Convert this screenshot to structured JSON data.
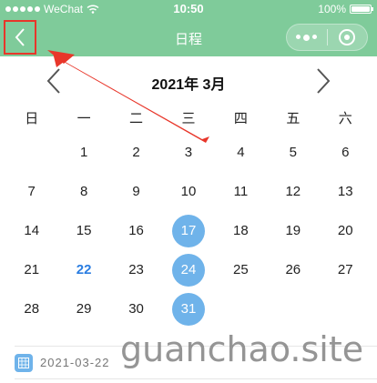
{
  "status_bar": {
    "carrier": "WeChat",
    "time": "10:50",
    "battery": "100%"
  },
  "nav": {
    "title": "日程"
  },
  "calendar": {
    "month_title": "2021年 3月",
    "weekdays": [
      "日",
      "一",
      "二",
      "三",
      "四",
      "五",
      "六"
    ],
    "days": [
      {
        "label": "",
        "state": "empty"
      },
      {
        "label": "1",
        "state": "normal"
      },
      {
        "label": "2",
        "state": "normal"
      },
      {
        "label": "3",
        "state": "normal"
      },
      {
        "label": "4",
        "state": "normal"
      },
      {
        "label": "5",
        "state": "normal"
      },
      {
        "label": "6",
        "state": "normal"
      },
      {
        "label": "7",
        "state": "normal"
      },
      {
        "label": "8",
        "state": "normal"
      },
      {
        "label": "9",
        "state": "normal"
      },
      {
        "label": "10",
        "state": "normal"
      },
      {
        "label": "11",
        "state": "normal"
      },
      {
        "label": "12",
        "state": "normal"
      },
      {
        "label": "13",
        "state": "normal"
      },
      {
        "label": "14",
        "state": "normal"
      },
      {
        "label": "15",
        "state": "normal"
      },
      {
        "label": "16",
        "state": "normal"
      },
      {
        "label": "17",
        "state": "marked"
      },
      {
        "label": "18",
        "state": "normal"
      },
      {
        "label": "19",
        "state": "normal"
      },
      {
        "label": "20",
        "state": "normal"
      },
      {
        "label": "21",
        "state": "normal"
      },
      {
        "label": "22",
        "state": "today"
      },
      {
        "label": "23",
        "state": "normal"
      },
      {
        "label": "24",
        "state": "marked"
      },
      {
        "label": "25",
        "state": "normal"
      },
      {
        "label": "26",
        "state": "normal"
      },
      {
        "label": "27",
        "state": "normal"
      },
      {
        "label": "28",
        "state": "normal"
      },
      {
        "label": "29",
        "state": "normal"
      },
      {
        "label": "30",
        "state": "normal"
      },
      {
        "label": "31",
        "state": "marked"
      }
    ]
  },
  "event": {
    "date": "2021-03-22",
    "icon": "calendar-icon"
  },
  "watermark": "guanchao.site",
  "colors": {
    "header_green": "#7fcb9a",
    "marked_blue": "#6fb3ea",
    "today_blue": "#2a7de1",
    "annotation_red": "#e8362a"
  }
}
